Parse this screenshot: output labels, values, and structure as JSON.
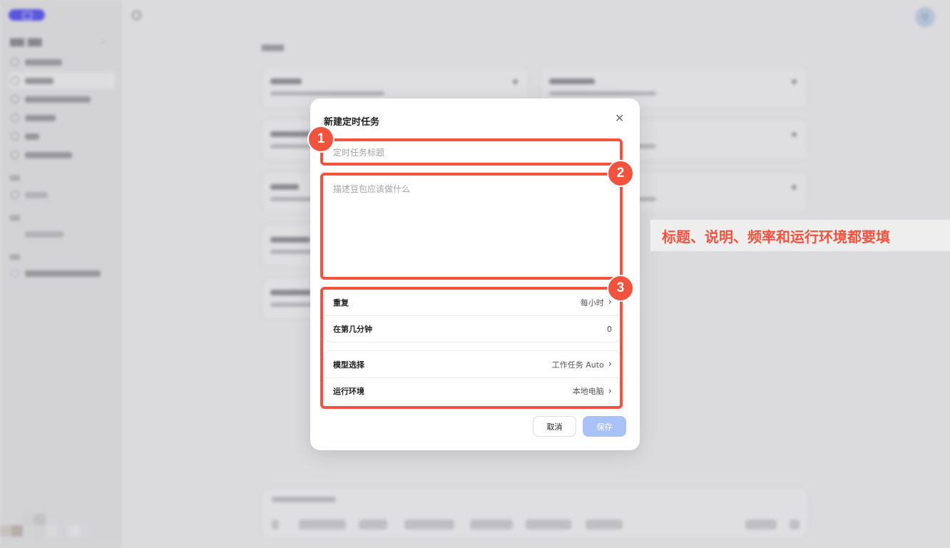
{
  "modal": {
    "title": "新建定时任务",
    "close_icon": "close-icon",
    "title_placeholder": "定时任务标题",
    "description_placeholder": "描述豆包应该做什么",
    "schedule": [
      {
        "label": "重复",
        "value": "每小时",
        "chevron": true
      },
      {
        "label": "在第几分钟",
        "value": "0",
        "chevron": false
      }
    ],
    "runtime": [
      {
        "label": "模型选择",
        "value": "工作任务 Auto",
        "chevron": true
      },
      {
        "label": "运行环境",
        "value": "本地电脑",
        "chevron": true
      }
    ],
    "cancel_label": "取消",
    "save_label": "保存"
  },
  "annotations": {
    "badge_1": "1",
    "badge_2": "2",
    "badge_3": "3",
    "note": "标题、说明、频率和运行环境都要填",
    "color": "#f1533f"
  },
  "colors": {
    "accent": "#5a54e6",
    "save_disabled": "#a9c3fa"
  }
}
